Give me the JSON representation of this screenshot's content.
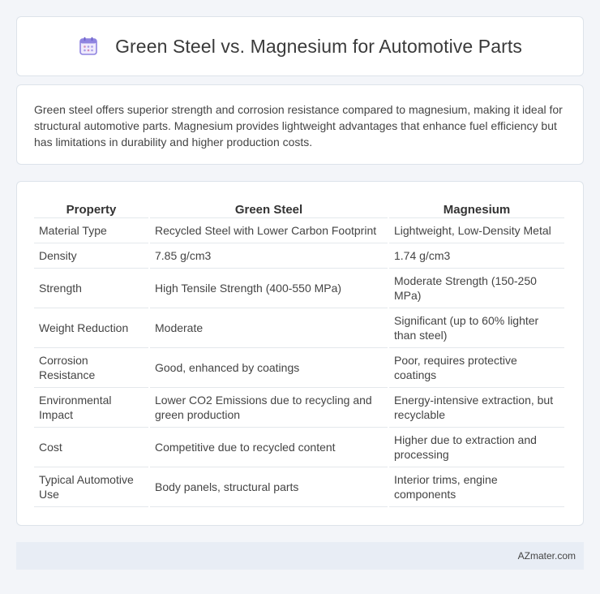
{
  "header": {
    "title": "Green Steel vs. Magnesium for Automotive Parts",
    "icon": "calendar-icon",
    "icon_color": "#7b6fd6"
  },
  "summary": {
    "text": "Green steel offers superior strength and corrosion resistance compared to magnesium, making it ideal for structural automotive parts. Magnesium provides lightweight advantages that enhance fuel efficiency but has limitations in durability and higher production costs."
  },
  "table": {
    "columns": [
      "Property",
      "Green Steel",
      "Magnesium"
    ],
    "rows": [
      [
        "Material Type",
        "Recycled Steel with Lower Carbon Footprint",
        "Lightweight, Low-Density Metal"
      ],
      [
        "Density",
        "7.85 g/cm3",
        "1.74 g/cm3"
      ],
      [
        "Strength",
        "High Tensile Strength (400-550 MPa)",
        "Moderate Strength (150-250 MPa)"
      ],
      [
        "Weight Reduction",
        "Moderate",
        "Significant (up to 60% lighter than steel)"
      ],
      [
        "Corrosion Resistance",
        "Good, enhanced by coatings",
        "Poor, requires protective coatings"
      ],
      [
        "Environmental Impact",
        "Lower CO2 Emissions due to recycling and green production",
        "Energy-intensive extraction, but recyclable"
      ],
      [
        "Cost",
        "Competitive due to recycled content",
        "Higher due to extraction and processing"
      ],
      [
        "Typical Automotive Use",
        "Body panels, structural parts",
        "Interior trims, engine components"
      ]
    ]
  },
  "footer": {
    "brand": "AZmater.com"
  }
}
